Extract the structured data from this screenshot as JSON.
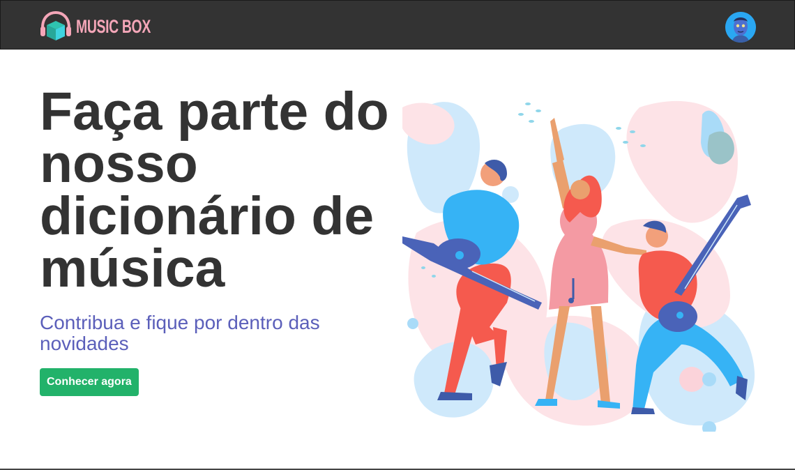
{
  "navbar": {
    "brand_name": "MUSIC BOX",
    "logo_icon": "headphones-cube-logo",
    "avatar_icon": "user-avatar"
  },
  "hero": {
    "title": "Faça parte do nosso dicionário de música",
    "subtitle": "Contribua e fique por dentro das novidades",
    "cta_label": "Conhecer agora",
    "illustration_icon": "musicians-illustration"
  },
  "colors": {
    "navbar_bg": "#333333",
    "brand": "#f4a6b8",
    "title": "#333333",
    "subtitle": "#5b5fba",
    "cta": "#22b26a"
  }
}
